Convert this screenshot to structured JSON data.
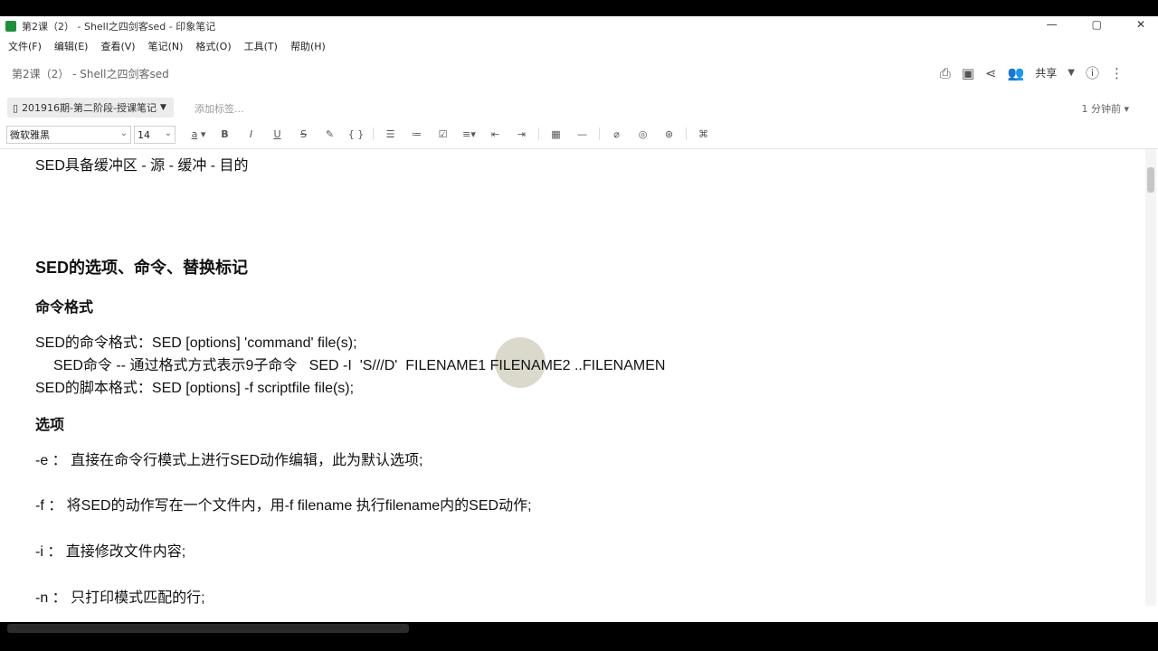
{
  "window": {
    "title": "第2课（2） - Shell之四剑客sed - 印象笔记",
    "minimize": "—",
    "restore": "▢",
    "close": "✕"
  },
  "menu": {
    "file": "文件(F)",
    "edit": "编辑(E)",
    "view": "查看(V)",
    "note": "笔记(N)",
    "format": "格式(O)",
    "tools": "工具(T)",
    "help": "帮助(H)"
  },
  "note": {
    "title": "第2课（2） - Shell之四剑客sed",
    "notebook": "201916期-第二阶段-授课笔记",
    "tag_placeholder": "添加标签...",
    "updated": "1 分钟前",
    "share_label": "共享"
  },
  "toolbar": {
    "font": "微软雅黑",
    "size": "14",
    "font_color_label": "a",
    "bold": "B",
    "italic": "I",
    "underline": "U",
    "strike": "S",
    "code": "{ }"
  },
  "content": {
    "line1": "SED具备缓冲区 - 源 - 缓冲 - 目的",
    "heading1": "SED的选项、命令、替换标记",
    "heading2": "命令格式",
    "cmd_format": "SED的命令格式：SED [options] 'command' file(s);",
    "cmd_example": "SED命令 -- 通过格式方式表示9子命令   SED -I  'S///D'  FILENAME1 FILENAME2 ..FILENAMEN",
    "script_format": "SED的脚本格式：SED [options] -f scriptfile file(s);",
    "heading3": "选项",
    "opt_e": "-e ： 直接在命令行模式上进行SED动作编辑，此为默认选项;",
    "opt_f": "-f ： 将SED的动作写在一个文件内，用-f filename 执行filename内的SED动作;",
    "opt_i": "-i ： 直接修改文件内容;",
    "opt_n": "-n ： 只打印模式匹配的行;"
  },
  "colors": {
    "notebook_bg": "#ececec",
    "accent_green": "#1f8f3a"
  }
}
